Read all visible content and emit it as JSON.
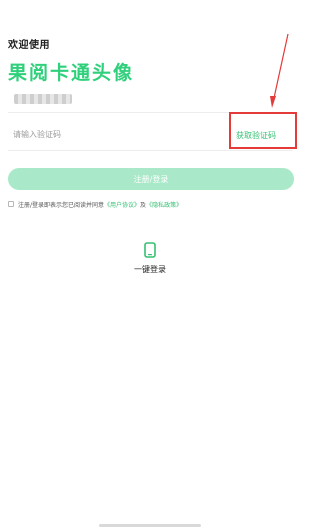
{
  "header": {
    "greeting": "欢迎使用",
    "app_name": "果阅卡通头像"
  },
  "form": {
    "code_placeholder": "请输入验证码",
    "get_code_label": "获取验证码",
    "submit_label": "注册/登录"
  },
  "agreement": {
    "prefix": "注册/登录即表示您已阅读并同意",
    "user_agreement": "《用户协议》",
    "and": "及",
    "privacy_policy": "《隐私政策》"
  },
  "one_click": {
    "label": "一键登录",
    "icon": "phone-icon"
  },
  "colors": {
    "accent": "#35c073",
    "button_disabled": "#a9e9c9",
    "highlight_box": "#e53a3a"
  }
}
